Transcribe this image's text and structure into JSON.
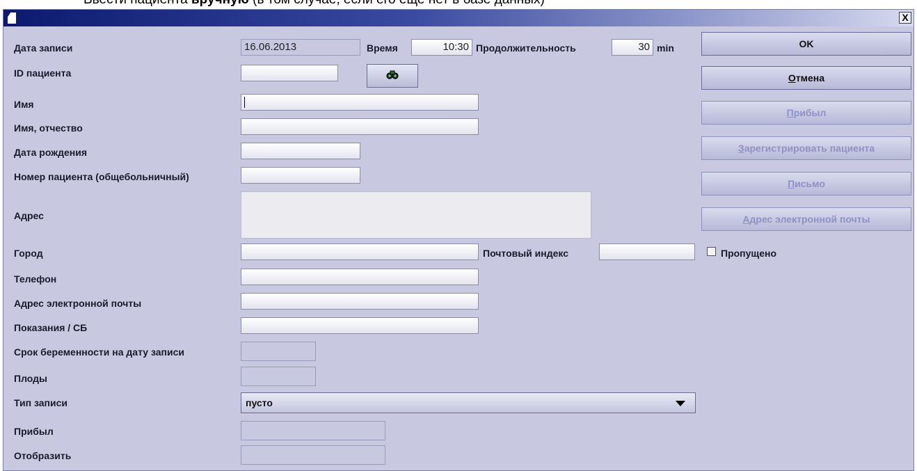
{
  "page_caption": {
    "part1": "Ввести пациента ",
    "bold": "вручную",
    "part2": " (в том случае, если его еще нет в базе данных)"
  },
  "window": {
    "close_label": "X"
  },
  "form": {
    "labels": {
      "record_date": "Дата записи",
      "time": "Время",
      "duration": "Продолжительность",
      "duration_unit": "min",
      "patient_id": "ID пациента",
      "first_name": "Имя",
      "name_patronymic": "Имя, отчество",
      "birth_date": "Дата рождения",
      "hospital_number": "Номер пациента (общебольничный)",
      "address": "Адрес",
      "city": "Город",
      "postal_code": "Почтовый индекс",
      "missed": "Пропущено",
      "phone": "Телефон",
      "email": "Адрес электронной почты",
      "indications": "Показания / СБ",
      "gestation": "Срок беременности на дату записи",
      "fetuses": "Плоды",
      "record_type": "Тип записи",
      "arrived": "Прибыл",
      "display": "Отобразить"
    },
    "values": {
      "record_date": "16.06.2013",
      "time": "10:30",
      "duration": "30",
      "patient_id": "",
      "first_name": "",
      "name_patronymic": "",
      "birth_date": "",
      "hospital_number": "",
      "address": "",
      "city": "",
      "postal_code": "",
      "missed_checked": false,
      "phone": "",
      "email": "",
      "indications": "",
      "gestation": "",
      "fetuses": "",
      "record_type": "пусто",
      "arrived": "",
      "display": ""
    }
  },
  "buttons": {
    "ok": "OK",
    "cancel_underlined": "О",
    "cancel_rest": "тмена",
    "arrived_underlined": "П",
    "arrived_rest": "рибыл",
    "register_underlined": "З",
    "register_rest": "арегистрировать пациента",
    "letter_underlined": "П",
    "letter_rest": "исьмо",
    "email_underlined": "А",
    "email_rest": "дрес электронной почты"
  },
  "icons": {
    "search": "binoculars-icon",
    "dropdown": "triangle-down-icon"
  }
}
